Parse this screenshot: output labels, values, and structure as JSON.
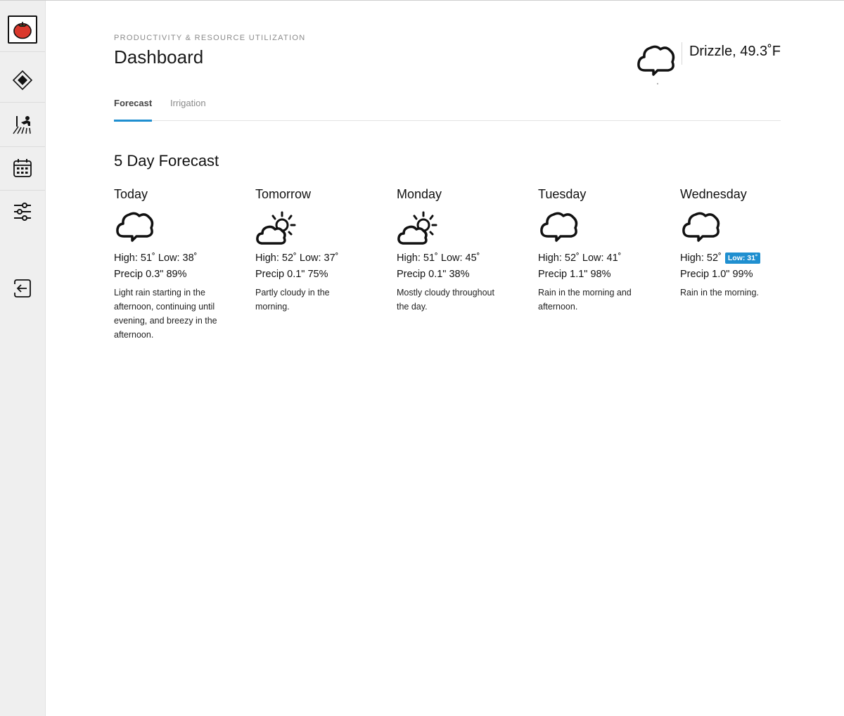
{
  "header": {
    "eyebrow": "PRODUCTIVITY & RESOURCE UTILIZATION",
    "title": "Dashboard"
  },
  "current_weather": {
    "text": "Drizzle, 49.3˚F",
    "icon": "cloud-rain-icon"
  },
  "sidebar": {
    "items": [
      {
        "icon": "tomato-logo-icon"
      },
      {
        "icon": "diamond-navigation-icon"
      },
      {
        "icon": "farmer-field-icon"
      },
      {
        "icon": "calendar-icon"
      },
      {
        "icon": "sliders-icon"
      },
      {
        "icon": "logout-icon"
      }
    ]
  },
  "tabs": [
    {
      "label": "Forecast",
      "active": true
    },
    {
      "label": "Irrigation",
      "active": false
    }
  ],
  "forecast": {
    "title": "5 Day Forecast",
    "days": [
      {
        "name": "Today",
        "icon": "cloud-rain-icon",
        "high": "High: 51˚",
        "low": "Low: 38˚",
        "precip": "Precip 0.3\" 89%",
        "desc": "Light rain starting in the afternoon, continuing until evening, and breezy in the afternoon."
      },
      {
        "name": "Tomorrow",
        "icon": "partly-cloudy-icon",
        "high": "High: 52˚",
        "low": "Low: 37˚",
        "precip": "Precip 0.1\" 75%",
        "desc": "Partly cloudy in the morning."
      },
      {
        "name": "Monday",
        "icon": "partly-cloudy-icon",
        "high": "High: 51˚",
        "low": "Low: 45˚",
        "precip": "Precip 0.1\" 38%",
        "desc": "Mostly cloudy throughout the day."
      },
      {
        "name": "Tuesday",
        "icon": "cloud-rain-icon",
        "high": "High: 52˚",
        "low": "Low: 41˚",
        "precip": "Precip 1.1\" 98%",
        "desc": "Rain in the morning and afternoon."
      },
      {
        "name": "Wednesday",
        "icon": "cloud-rain-icon",
        "high": "High: 52˚",
        "low": "Low: 31˚",
        "precip": "Precip 1.0\" 99%",
        "desc": "Rain in the morning.",
        "low_highlighted": true
      }
    ]
  },
  "colors": {
    "accent": "#1f8fd0",
    "tomato": "#d9382c",
    "sidebar_bg": "#efefef"
  }
}
